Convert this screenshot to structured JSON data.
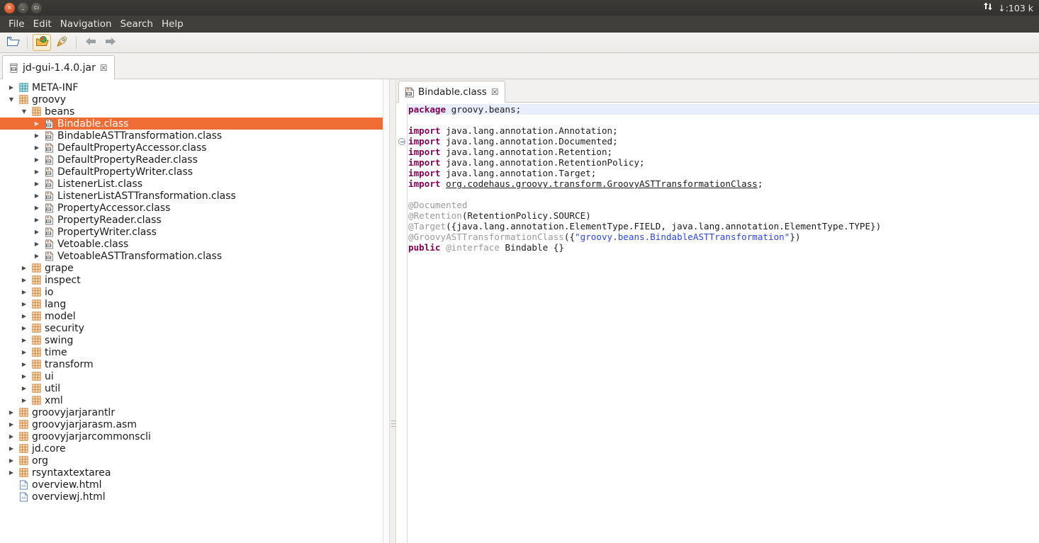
{
  "titlebar": {
    "buttons": [
      {
        "name": "close",
        "glyph": "×"
      },
      {
        "name": "minimize",
        "glyph": "–"
      },
      {
        "name": "maximize",
        "glyph": "▭"
      }
    ],
    "tray_network": "↓:103 k",
    "tray_icon": "up-down-arrows-icon"
  },
  "menubar": {
    "items": [
      {
        "label": "File"
      },
      {
        "label": "Edit"
      },
      {
        "label": "Navigation"
      },
      {
        "label": "Search"
      },
      {
        "label": "Help"
      }
    ]
  },
  "toolbar": {
    "buttons": [
      {
        "name": "open-file-icon",
        "pressed": false
      },
      {
        "name": "open-recent-icon",
        "pressed": true
      },
      {
        "name": "search-rocket-icon",
        "pressed": false
      },
      {
        "name": "back-arrow-icon",
        "pressed": false
      },
      {
        "name": "forward-arrow-icon",
        "pressed": false
      }
    ]
  },
  "jar_tab": {
    "label": "jd-gui-1.4.0.jar",
    "close_glyph": "☒",
    "icon": "jar-icon"
  },
  "tree": {
    "items": [
      {
        "label": "META-INF",
        "depth": 0,
        "icon": "package-icon",
        "icon_color": "teal",
        "arrow": "collapsed",
        "selected": false
      },
      {
        "label": "groovy",
        "depth": 0,
        "icon": "package-icon",
        "icon_color": "orange",
        "arrow": "expanded",
        "selected": false
      },
      {
        "label": "beans",
        "depth": 1,
        "icon": "package-icon",
        "icon_color": "orange",
        "arrow": "expanded",
        "selected": false
      },
      {
        "label": "Bindable.class",
        "depth": 2,
        "icon": "class-icon",
        "arrow": "collapsed",
        "selected": true
      },
      {
        "label": "BindableASTTransformation.class",
        "depth": 2,
        "icon": "class-icon",
        "arrow": "collapsed",
        "selected": false
      },
      {
        "label": "DefaultPropertyAccessor.class",
        "depth": 2,
        "icon": "class-icon",
        "arrow": "collapsed",
        "selected": false
      },
      {
        "label": "DefaultPropertyReader.class",
        "depth": 2,
        "icon": "class-icon",
        "arrow": "collapsed",
        "selected": false
      },
      {
        "label": "DefaultPropertyWriter.class",
        "depth": 2,
        "icon": "class-icon",
        "arrow": "collapsed",
        "selected": false
      },
      {
        "label": "ListenerList.class",
        "depth": 2,
        "icon": "class-icon",
        "arrow": "collapsed",
        "selected": false
      },
      {
        "label": "ListenerListASTTransformation.class",
        "depth": 2,
        "icon": "class-icon",
        "arrow": "collapsed",
        "selected": false
      },
      {
        "label": "PropertyAccessor.class",
        "depth": 2,
        "icon": "class-icon",
        "arrow": "collapsed",
        "selected": false
      },
      {
        "label": "PropertyReader.class",
        "depth": 2,
        "icon": "class-icon",
        "arrow": "collapsed",
        "selected": false
      },
      {
        "label": "PropertyWriter.class",
        "depth": 2,
        "icon": "class-icon",
        "arrow": "collapsed",
        "selected": false
      },
      {
        "label": "Vetoable.class",
        "depth": 2,
        "icon": "class-icon",
        "arrow": "collapsed",
        "selected": false
      },
      {
        "label": "VetoableASTTransformation.class",
        "depth": 2,
        "icon": "class-icon",
        "arrow": "collapsed",
        "selected": false
      },
      {
        "label": "grape",
        "depth": 1,
        "icon": "package-icon",
        "icon_color": "orange",
        "arrow": "collapsed",
        "selected": false
      },
      {
        "label": "inspect",
        "depth": 1,
        "icon": "package-icon",
        "icon_color": "orange",
        "arrow": "collapsed",
        "selected": false
      },
      {
        "label": "io",
        "depth": 1,
        "icon": "package-icon",
        "icon_color": "orange",
        "arrow": "collapsed",
        "selected": false
      },
      {
        "label": "lang",
        "depth": 1,
        "icon": "package-icon",
        "icon_color": "orange",
        "arrow": "collapsed",
        "selected": false
      },
      {
        "label": "model",
        "depth": 1,
        "icon": "package-icon",
        "icon_color": "orange",
        "arrow": "collapsed",
        "selected": false
      },
      {
        "label": "security",
        "depth": 1,
        "icon": "package-icon",
        "icon_color": "orange",
        "arrow": "collapsed",
        "selected": false
      },
      {
        "label": "swing",
        "depth": 1,
        "icon": "package-icon",
        "icon_color": "orange",
        "arrow": "collapsed",
        "selected": false
      },
      {
        "label": "time",
        "depth": 1,
        "icon": "package-icon",
        "icon_color": "orange",
        "arrow": "collapsed",
        "selected": false
      },
      {
        "label": "transform",
        "depth": 1,
        "icon": "package-icon",
        "icon_color": "orange",
        "arrow": "collapsed",
        "selected": false
      },
      {
        "label": "ui",
        "depth": 1,
        "icon": "package-icon",
        "icon_color": "orange",
        "arrow": "collapsed",
        "selected": false
      },
      {
        "label": "util",
        "depth": 1,
        "icon": "package-icon",
        "icon_color": "orange",
        "arrow": "collapsed",
        "selected": false
      },
      {
        "label": "xml",
        "depth": 1,
        "icon": "package-icon",
        "icon_color": "orange",
        "arrow": "collapsed",
        "selected": false
      },
      {
        "label": "groovyjarjarantlr",
        "depth": 0,
        "icon": "package-icon",
        "icon_color": "orange",
        "arrow": "collapsed",
        "selected": false
      },
      {
        "label": "groovyjarjarasm.asm",
        "depth": 0,
        "icon": "package-icon",
        "icon_color": "orange",
        "arrow": "collapsed",
        "selected": false
      },
      {
        "label": "groovyjarjarcommonscli",
        "depth": 0,
        "icon": "package-icon",
        "icon_color": "orange",
        "arrow": "collapsed",
        "selected": false
      },
      {
        "label": "jd.core",
        "depth": 0,
        "icon": "package-icon",
        "icon_color": "orange",
        "arrow": "collapsed",
        "selected": false
      },
      {
        "label": "org",
        "depth": 0,
        "icon": "package-icon",
        "icon_color": "orange",
        "arrow": "collapsed",
        "selected": false
      },
      {
        "label": "rsyntaxtextarea",
        "depth": 0,
        "icon": "package-icon",
        "icon_color": "orange",
        "arrow": "collapsed",
        "selected": false
      },
      {
        "label": "overview.html",
        "depth": 0,
        "icon": "html-icon",
        "arrow": "none",
        "selected": false
      },
      {
        "label": "overviewj.html",
        "depth": 0,
        "icon": "html-icon",
        "arrow": "none",
        "selected": false
      }
    ]
  },
  "editor": {
    "tab": {
      "label": "Bindable.class",
      "close_glyph": "☒",
      "icon": "class-icon"
    },
    "fold_marker": "collapse-icon",
    "lines": [
      {
        "current": true,
        "tokens": [
          {
            "t": "package",
            "c": "kw"
          },
          {
            "t": " groovy.beans;",
            "c": "plain"
          }
        ]
      },
      {
        "current": false,
        "tokens": []
      },
      {
        "current": false,
        "tokens": [
          {
            "t": "import",
            "c": "kw"
          },
          {
            "t": " java.lang.annotation.Annotation;",
            "c": "plain"
          }
        ]
      },
      {
        "current": false,
        "tokens": [
          {
            "t": "import",
            "c": "kw"
          },
          {
            "t": " java.lang.annotation.Documented;",
            "c": "plain"
          }
        ]
      },
      {
        "current": false,
        "tokens": [
          {
            "t": "import",
            "c": "kw"
          },
          {
            "t": " java.lang.annotation.Retention;",
            "c": "plain"
          }
        ]
      },
      {
        "current": false,
        "tokens": [
          {
            "t": "import",
            "c": "kw"
          },
          {
            "t": " java.lang.annotation.RetentionPolicy;",
            "c": "plain"
          }
        ]
      },
      {
        "current": false,
        "tokens": [
          {
            "t": "import",
            "c": "kw"
          },
          {
            "t": " java.lang.annotation.Target;",
            "c": "plain"
          }
        ]
      },
      {
        "current": false,
        "tokens": [
          {
            "t": "import",
            "c": "kw"
          },
          {
            "t": " ",
            "c": "plain"
          },
          {
            "t": "org.codehaus.groovy.transform.GroovyASTTransformationClass",
            "c": "lnk"
          },
          {
            "t": ";",
            "c": "plain"
          }
        ]
      },
      {
        "current": false,
        "tokens": []
      },
      {
        "current": false,
        "tokens": [
          {
            "t": "@Documented",
            "c": "ann"
          }
        ]
      },
      {
        "current": false,
        "tokens": [
          {
            "t": "@Retention",
            "c": "ann"
          },
          {
            "t": "(RetentionPolicy.SOURCE)",
            "c": "plain"
          }
        ]
      },
      {
        "current": false,
        "tokens": [
          {
            "t": "@Target",
            "c": "ann"
          },
          {
            "t": "({java.lang.annotation.ElementType.FIELD, java.lang.annotation.ElementType.TYPE})",
            "c": "plain"
          }
        ]
      },
      {
        "current": false,
        "tokens": [
          {
            "t": "@GroovyASTTransformationClass",
            "c": "ann"
          },
          {
            "t": "({",
            "c": "plain"
          },
          {
            "t": "\"groovy.beans.BindableASTTransformation\"",
            "c": "str"
          },
          {
            "t": "})",
            "c": "plain"
          }
        ]
      },
      {
        "current": false,
        "tokens": [
          {
            "t": "public",
            "c": "kw"
          },
          {
            "t": " ",
            "c": "plain"
          },
          {
            "t": "@interface",
            "c": "ann"
          },
          {
            "t": " Bindable {}",
            "c": "plain"
          }
        ]
      }
    ]
  },
  "colors": {
    "selection": "#ef6d35",
    "current_line": "#e8eefc",
    "keyword": "#7f0055",
    "annotation": "#9a9a9a",
    "string": "#2a47d8",
    "titlebar": "#3c3b37"
  }
}
